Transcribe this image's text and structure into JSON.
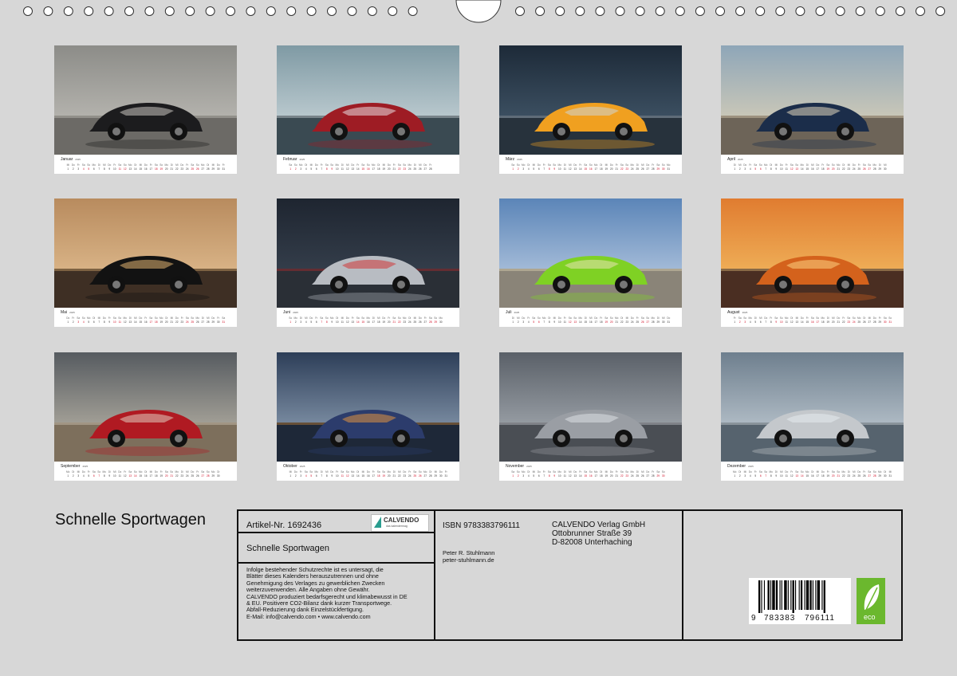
{
  "calendar_title": "Schnelle Sportwagen",
  "weekday_abbrevs": [
    "Mo",
    "Di",
    "Mi",
    "Do",
    "Fr",
    "Sa",
    "So"
  ],
  "months": [
    {
      "name": "Januar",
      "year": "2025",
      "days": 31,
      "first_weekday": 2,
      "photo": "black-hypercar-city-street"
    },
    {
      "name": "Februar",
      "year": "2025",
      "days": 28,
      "first_weekday": 5,
      "photo": "red-sportscar-wet-road"
    },
    {
      "name": "März",
      "year": "2025",
      "days": 31,
      "first_weekday": 5,
      "photo": "orange-supercar-rain"
    },
    {
      "name": "April",
      "year": "2025",
      "days": 30,
      "first_weekday": 1,
      "photo": "blue-coupe-coastal-road"
    },
    {
      "name": "Mai",
      "year": "2025",
      "days": 31,
      "first_weekday": 3,
      "photo": "black-hypercar-old-town"
    },
    {
      "name": "Juni",
      "year": "2025",
      "days": 30,
      "first_weekday": 6,
      "photo": "silver-sportscar-night-city"
    },
    {
      "name": "Juli",
      "year": "2025",
      "days": 31,
      "first_weekday": 1,
      "photo": "lime-green-supercar-promenade"
    },
    {
      "name": "August",
      "year": "2025",
      "days": 31,
      "first_weekday": 4,
      "photo": "orange-hypercar-sunset"
    },
    {
      "name": "September",
      "year": "2025",
      "days": 30,
      "first_weekday": 0,
      "photo": "red-roadster-desert-road"
    },
    {
      "name": "Oktober",
      "year": "2025",
      "days": 31,
      "first_weekday": 2,
      "photo": "blue-sportscar-lake-reflection"
    },
    {
      "name": "November",
      "year": "2025",
      "days": 30,
      "first_weekday": 5,
      "photo": "silver-supercar-garage"
    },
    {
      "name": "Dezember",
      "year": "2025",
      "days": 31,
      "first_weekday": 0,
      "photo": "silver-coupe-harbor"
    }
  ],
  "info": {
    "article_no": "Artikel-Nr. 1692436",
    "title": "Schnelle Sportwagen",
    "calvendo_logo_text": "CALVENDO",
    "calvendo_logo_sub": "das kalendermag",
    "legal_lines": [
      "Infolge bestehender Schutzrechte ist es untersagt, die",
      "Blätter dieses Kalenders herauszutrennen und ohne",
      "Genehmigung des Verlages zu gewerblichen Zwecken",
      "weiterzuverwenden. Alle Angaben ohne Gewähr.",
      "CALVENDO produziert bedarfsgerecht und klimabewusst in DE",
      "& EU. Positivere CO2-Bilanz dank kurzer Transportwege.",
      "Abfall-Reduzierung dank Einzelstückfertigung.",
      "E-Mail: info@calvendo.com • www.calvendo.com"
    ],
    "isbn": "ISBN 9783383796111",
    "author_name": "Peter R. Stuhlmann",
    "author_site": "peter-stuhlmann.de",
    "publisher_lines": [
      "CALVENDO Verlag GmbH",
      "Ottobrunner Straße 39",
      "D-82008 Unterhaching"
    ],
    "barcode_left": "9",
    "barcode_group1": "783383",
    "barcode_group2": "796111",
    "eco_label": "eco"
  },
  "colors": {
    "background": "#d7d7d7",
    "weekend_red": "#d0021b",
    "eco_green": "#6bb82e",
    "calvendo_teal": "#2a9d8f"
  }
}
